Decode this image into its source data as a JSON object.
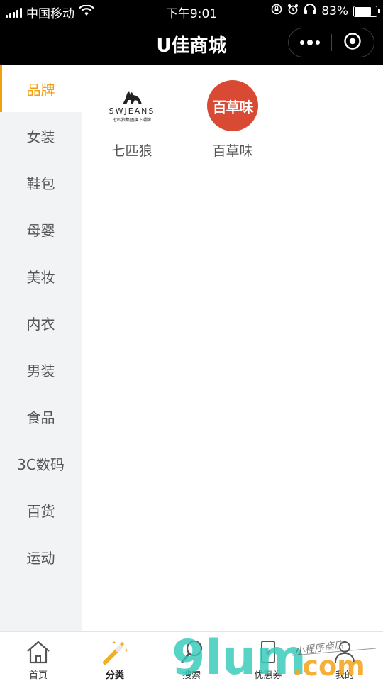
{
  "status_bar": {
    "carrier": "中国移动",
    "time": "下午9:01",
    "battery_percent": "83%",
    "battery_level": 0.83,
    "icons": [
      "signal-icon",
      "wifi-icon",
      "rotation-lock-icon",
      "alarm-icon",
      "headphones-icon",
      "battery-icon"
    ]
  },
  "nav": {
    "title": "U佳商城",
    "menu_icon": "more-dots-icon",
    "close_icon": "target-close-icon"
  },
  "sidebar": {
    "items": [
      {
        "label": "品牌",
        "active": true
      },
      {
        "label": "女装",
        "active": false
      },
      {
        "label": "鞋包",
        "active": false
      },
      {
        "label": "母婴",
        "active": false
      },
      {
        "label": "美妆",
        "active": false
      },
      {
        "label": "内衣",
        "active": false
      },
      {
        "label": "男装",
        "active": false
      },
      {
        "label": "食品",
        "active": false
      },
      {
        "label": "3C数码",
        "active": false
      },
      {
        "label": "百货",
        "active": false
      },
      {
        "label": "运动",
        "active": false
      }
    ]
  },
  "brands": [
    {
      "name": "七匹狼",
      "logo_text": "SWJEANS",
      "logo_sub": "七匹狼集团旗下潮牌"
    },
    {
      "name": "百草味",
      "logo_text": "百草味"
    }
  ],
  "tabs": [
    {
      "label": "首页",
      "icon": "home-icon",
      "active": false
    },
    {
      "label": "分类",
      "icon": "magic-wand-icon",
      "active": true
    },
    {
      "label": "搜索",
      "icon": "search-icon",
      "active": false
    },
    {
      "label": "优惠券",
      "icon": "coupon-icon",
      "active": false
    },
    {
      "label": "我的",
      "icon": "user-icon",
      "active": false
    }
  ],
  "watermark": {
    "text": "9lum",
    "domain": ".com",
    "handwriting": "小程序商店"
  },
  "colors": {
    "accent": "#f0a010",
    "sidebar_bg": "#f2f3f5",
    "header_bg": "#000000",
    "brand_red": "#d94a35"
  }
}
